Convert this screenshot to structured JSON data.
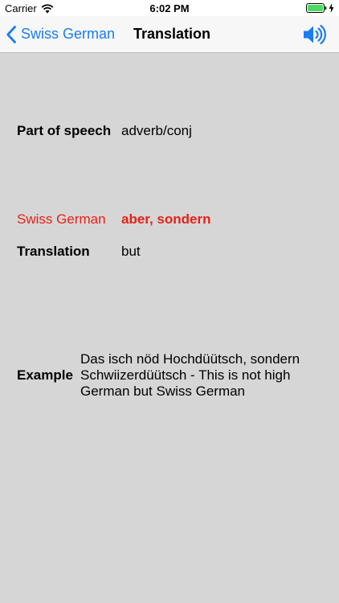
{
  "status_bar": {
    "carrier": "Carrier",
    "time": "6:02 PM",
    "wifi_icon": "wifi-icon",
    "battery_icon": "battery-icon",
    "charge_icon": "charge-icon",
    "battery_color": "#4cd964"
  },
  "nav": {
    "back_label": "Swiss German",
    "back_icon": "chevron-left-icon",
    "title": "Translation",
    "speaker_icon": "speaker-icon",
    "accent_color": "#1a7cf2"
  },
  "entry": {
    "part_of_speech_label": "Part of speech",
    "part_of_speech_value": "adverb/conj",
    "swiss_german_label": "Swiss German",
    "swiss_german_value": "aber, sondern",
    "translation_label": "Translation",
    "translation_value": "but",
    "example_label": "Example",
    "example_value": "Das isch nöd Hochdüütsch, sondern Schwiizerdüütsch - This is not high German but Swiss German",
    "highlight_color": "#e62117"
  }
}
